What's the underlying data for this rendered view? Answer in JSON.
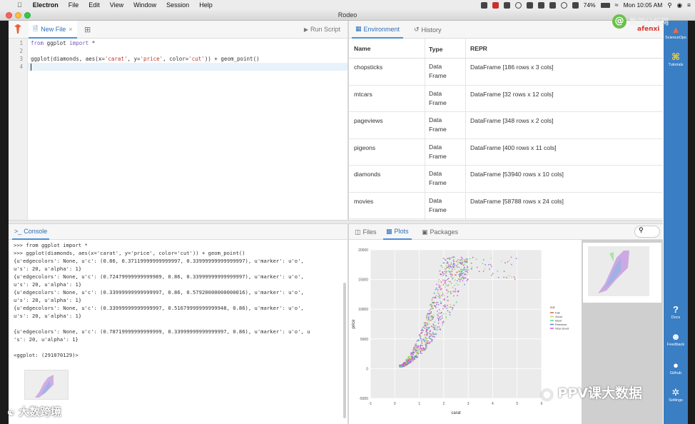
{
  "menubar": {
    "apple": "",
    "app": "Electron",
    "items": [
      "File",
      "Edit",
      "View",
      "Window",
      "Session",
      "Help"
    ],
    "battery": "74%",
    "clock": "Mon 10:05 AM"
  },
  "window": {
    "title": "Rodeo"
  },
  "editor": {
    "tab_label": "New File",
    "tab_close": "×",
    "add_tab": "⊞",
    "run_script": "Run Script",
    "line_numbers": [
      "1",
      "2",
      "3",
      "4"
    ],
    "line1_kw1": "from",
    "line1_mod": " ggplot ",
    "line1_kw2": "import",
    "line1_rest": " *",
    "line3_a": "ggplot(diamonds, aes(x=",
    "line3_s1": "'carat'",
    "line3_b": ", y=",
    "line3_s2": "'price'",
    "line3_c": ", color=",
    "line3_s3": "'cut'",
    "line3_d": ")) + geom_point()"
  },
  "env": {
    "tab_environment": "Environment",
    "tab_history": "History",
    "headers": {
      "name": "Name",
      "type": "Type",
      "repr": "REPR"
    },
    "rows": [
      {
        "name": "chopsticks",
        "type": "Data Frame",
        "repr": "DataFrame [186 rows x 3 cols]"
      },
      {
        "name": "mtcars",
        "type": "Data Frame",
        "repr": "DataFrame [32 rows x 12 cols]"
      },
      {
        "name": "pageviews",
        "type": "Data Frame",
        "repr": "DataFrame [348 rows x 2 cols]"
      },
      {
        "name": "pigeons",
        "type": "Data Frame",
        "repr": "DataFrame [400 rows x 11 cols]"
      },
      {
        "name": "diamonds",
        "type": "Data Frame",
        "repr": "DataFrame [53940 rows x 10 cols]"
      },
      {
        "name": "movies",
        "type": "Data Frame",
        "repr": "DataFrame [58788 rows x 24 cols]"
      }
    ]
  },
  "console": {
    "tab_label": "Console",
    "tab_icon": ">_",
    "lines": [
      ">>> from ggplot import *",
      ">>> ggplot(diamonds, aes(x='carat', y='price', color='cut')) + geom_point()",
      "{u'edgecolors': None, u'c': (0.86, 0.37119999999999997, 0.33999999999999997), u'marker': u'o',",
      "u's': 20, u'alpha': 1}",
      "{u'edgecolors': None, u'c': (0.72479999999999989, 0.86, 0.33999999999999997), u'marker': u'o',",
      "u's': 20, u'alpha': 1}",
      "{u'edgecolors': None, u'c': (0.33999999999999997, 0.86, 0.57920000000000016), u'marker': u'o',",
      "u's': 20, u'alpha': 1}",
      "{u'edgecolors': None, u'c': (0.33999999999999997, 0.51679999999999948, 0.86), u'marker': u'o',",
      "u's': 20, u'alpha': 1}",
      "",
      "{u'edgecolors': None, u'c': (0.78719999999999999, 0.33999999999999997, 0.86), u'marker': u'o', u",
      "'s': 20, u'alpha': 1}",
      "",
      "<ggplot: (291070129)>"
    ]
  },
  "plots": {
    "tab_files": "Files",
    "tab_plots": "Plots",
    "tab_packages": "Packages",
    "search_icon": "search-icon"
  },
  "chart_data": {
    "type": "scatter",
    "title": "",
    "xlabel": "carat",
    "ylabel": "price",
    "xlim": [
      -1,
      6
    ],
    "ylim": [
      -5000,
      20000
    ],
    "x_ticks": [
      "-1",
      "0",
      "1",
      "2",
      "3",
      "4",
      "5",
      "6"
    ],
    "y_ticks": [
      "-5000",
      "0",
      "5000",
      "10000",
      "15000",
      "20000"
    ],
    "grid": true,
    "legend_title": "cut",
    "legend_position": "right",
    "series": [
      {
        "name": "Fair",
        "color": "#db5f57"
      },
      {
        "name": "Good",
        "color": "#b9db57"
      },
      {
        "name": "Ideal",
        "color": "#57db94"
      },
      {
        "name": "Premium",
        "color": "#5784db"
      },
      {
        "name": "Very Good",
        "color": "#c957db"
      }
    ]
  },
  "sidebar": {
    "items": [
      {
        "label": "ScienceOps",
        "icon": "▲"
      },
      {
        "label": "Tutorials",
        "icon": "⌘"
      },
      {
        "label": "Docs",
        "icon": "?"
      },
      {
        "label": "Feedback",
        "icon": "☻"
      },
      {
        "label": "Github",
        "icon": "●"
      },
      {
        "label": "Settings",
        "icon": "✲"
      }
    ]
  },
  "watermarks": {
    "top_right": "数据分析网",
    "top_right_sub": "afenxi",
    "bottom_right": "PPV课大数据",
    "bottom_left": "大数跨境"
  }
}
